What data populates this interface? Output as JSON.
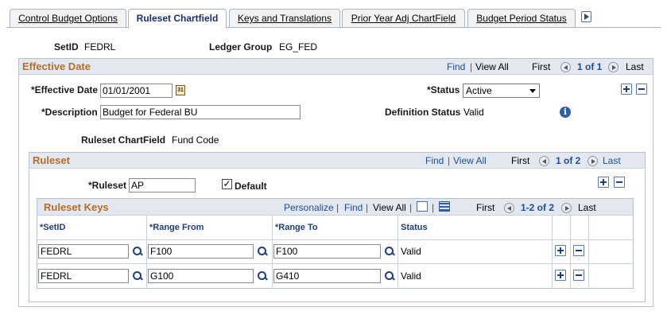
{
  "tabs": [
    {
      "label": "Control Budget Options",
      "active": false
    },
    {
      "label": "Ruleset Chartfield",
      "active": true
    },
    {
      "label": "Keys and Translations",
      "active": false
    },
    {
      "label": "Prior Year Adj ChartField",
      "active": false
    },
    {
      "label": "Budget Period Status",
      "active": false
    }
  ],
  "header": {
    "setid_label": "SetID",
    "setid_value": "FEDRL",
    "ledger_group_label": "Ledger Group",
    "ledger_group_value": "EG_FED"
  },
  "effective": {
    "title": "Effective Date",
    "nav": {
      "find": "Find",
      "sep": "|",
      "view_all": "View All",
      "first": "First",
      "count": "1 of 1",
      "last": "Last"
    },
    "eff_date_label": "*Effective Date",
    "eff_date_value": "01/01/2001",
    "calendar_icon_text": "31",
    "status_label": "*Status",
    "status_value": "Active",
    "description_label": "*Description",
    "description_value": "Budget for Federal BU",
    "def_status_label": "Definition Status",
    "def_status_value": "Valid",
    "ruleset_cf_label": "Ruleset ChartField",
    "ruleset_cf_value": "Fund Code"
  },
  "ruleset": {
    "title": "Ruleset",
    "nav": {
      "find": "Find",
      "sep": "|",
      "view_all": "View All",
      "first": "First",
      "count": "1 of 2",
      "last": "Last"
    },
    "ruleset_label": "*Ruleset",
    "ruleset_value": "AP",
    "default_label": "Default",
    "default_checked": "✓"
  },
  "keys": {
    "title": "Ruleset Keys",
    "nav": {
      "personalize": "Personalize",
      "sep": "|",
      "find": "Find",
      "view_all": "View All",
      "first": "First",
      "count": "1-2 of 2",
      "last": "Last"
    },
    "columns": [
      "*SetID",
      "*Range From",
      "*Range To",
      "Status"
    ],
    "rows": [
      {
        "setid": "FEDRL",
        "from": "F100",
        "to": "F100",
        "status": "Valid"
      },
      {
        "setid": "FEDRL",
        "from": "G100",
        "to": "G410",
        "status": "Valid"
      }
    ]
  }
}
